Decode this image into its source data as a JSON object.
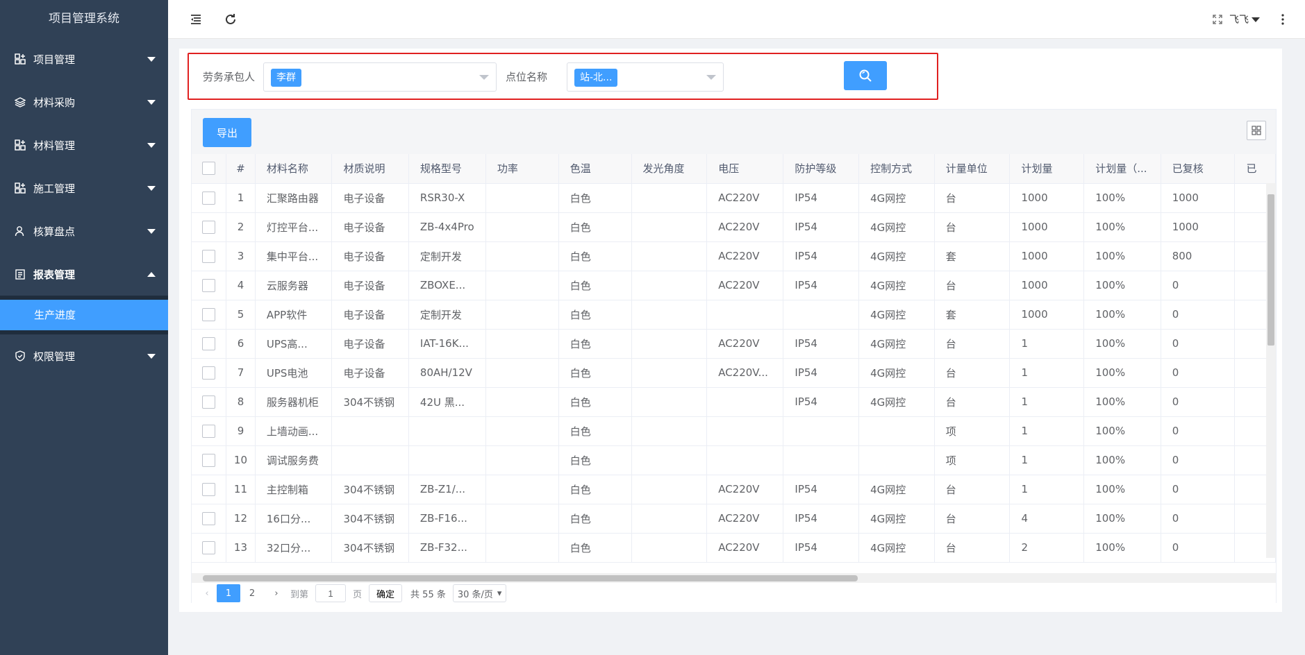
{
  "app": {
    "title": "项目管理系统"
  },
  "sidebar": {
    "items": [
      {
        "label": "项目管理",
        "icon": "project-icon"
      },
      {
        "label": "材料采购",
        "icon": "stack-icon"
      },
      {
        "label": "材料管理",
        "icon": "material-icon"
      },
      {
        "label": "施工管理",
        "icon": "construction-icon"
      },
      {
        "label": "核算盘点",
        "icon": "user-icon"
      },
      {
        "label": "报表管理",
        "icon": "report-icon",
        "expanded": true
      },
      {
        "label": "权限管理",
        "icon": "shield-icon"
      }
    ],
    "active_sub": "生产进度"
  },
  "header": {
    "user": "飞飞"
  },
  "filter": {
    "labor_label": "劳务承包人",
    "labor_value": "李群",
    "site_label": "点位名称",
    "site_value": "站-北..."
  },
  "toolbar": {
    "export_label": "导出"
  },
  "table": {
    "columns": [
      "#",
      "材料名称",
      "材质说明",
      "规格型号",
      "功率",
      "色温",
      "发光角度",
      "电压",
      "防护等级",
      "控制方式",
      "计量单位",
      "计划量",
      "计划量（...",
      "已复核",
      "已"
    ],
    "rows": [
      [
        "1",
        "汇聚路由器",
        "电子设备",
        "RSR30-X",
        "",
        "白色",
        "",
        "AC220V",
        "IP54",
        "4G网控",
        "台",
        "1000",
        "100%",
        "1000",
        ""
      ],
      [
        "2",
        "灯控平台...",
        "电子设备",
        "ZB-4x4Pro",
        "",
        "白色",
        "",
        "AC220V",
        "IP54",
        "4G网控",
        "台",
        "1000",
        "100%",
        "1000",
        ""
      ],
      [
        "3",
        "集中平台...",
        "电子设备",
        "定制开发",
        "",
        "白色",
        "",
        "AC220V",
        "IP54",
        "4G网控",
        "套",
        "1000",
        "100%",
        "800",
        ""
      ],
      [
        "4",
        "云服务器",
        "电子设备",
        "ZBOXE...",
        "",
        "白色",
        "",
        "AC220V",
        "IP54",
        "4G网控",
        "台",
        "1000",
        "100%",
        "0",
        ""
      ],
      [
        "5",
        "APP软件",
        "电子设备",
        "定制开发",
        "",
        "白色",
        "",
        "",
        "",
        "4G网控",
        "套",
        "1000",
        "100%",
        "0",
        ""
      ],
      [
        "6",
        "UPS高...",
        "电子设备",
        "IAT-16K...",
        "",
        "白色",
        "",
        "AC220V",
        "IP54",
        "4G网控",
        "台",
        "1",
        "100%",
        "0",
        ""
      ],
      [
        "7",
        "UPS电池",
        "电子设备",
        "80AH/12V",
        "",
        "白色",
        "",
        "AC220V...",
        "IP54",
        "4G网控",
        "台",
        "1",
        "100%",
        "0",
        ""
      ],
      [
        "8",
        "服务器机柜",
        "304不锈钢",
        "42U 黑...",
        "",
        "白色",
        "",
        "",
        "IP54",
        "4G网控",
        "台",
        "1",
        "100%",
        "0",
        ""
      ],
      [
        "9",
        "上墙动画...",
        "",
        "",
        "",
        "白色",
        "",
        "",
        "",
        "",
        "项",
        "1",
        "100%",
        "0",
        ""
      ],
      [
        "10",
        "调试服务费",
        "",
        "",
        "",
        "白色",
        "",
        "",
        "",
        "",
        "项",
        "1",
        "100%",
        "0",
        ""
      ],
      [
        "11",
        "主控制箱",
        "304不锈钢",
        "ZB-Z1/...",
        "",
        "白色",
        "",
        "AC220V",
        "IP54",
        "4G网控",
        "台",
        "1",
        "100%",
        "0",
        ""
      ],
      [
        "12",
        "16口分...",
        "304不锈钢",
        "ZB-F16...",
        "",
        "白色",
        "",
        "AC220V",
        "IP54",
        "4G网控",
        "台",
        "4",
        "100%",
        "0",
        ""
      ],
      [
        "13",
        "32口分...",
        "304不锈钢",
        "ZB-F32...",
        "",
        "白色",
        "",
        "AC220V",
        "IP54",
        "4G网控",
        "台",
        "2",
        "100%",
        "0",
        ""
      ]
    ]
  },
  "pagination": {
    "pages": [
      "1",
      "2"
    ],
    "current": "1",
    "goto_label": "到第",
    "goto_value": "1",
    "page_unit": "页",
    "confirm": "确定",
    "total": "共 55 条",
    "page_size": "30 条/页"
  },
  "colors": {
    "primary": "#409eff",
    "sidebar": "#304156",
    "highlight": "#e02020"
  }
}
